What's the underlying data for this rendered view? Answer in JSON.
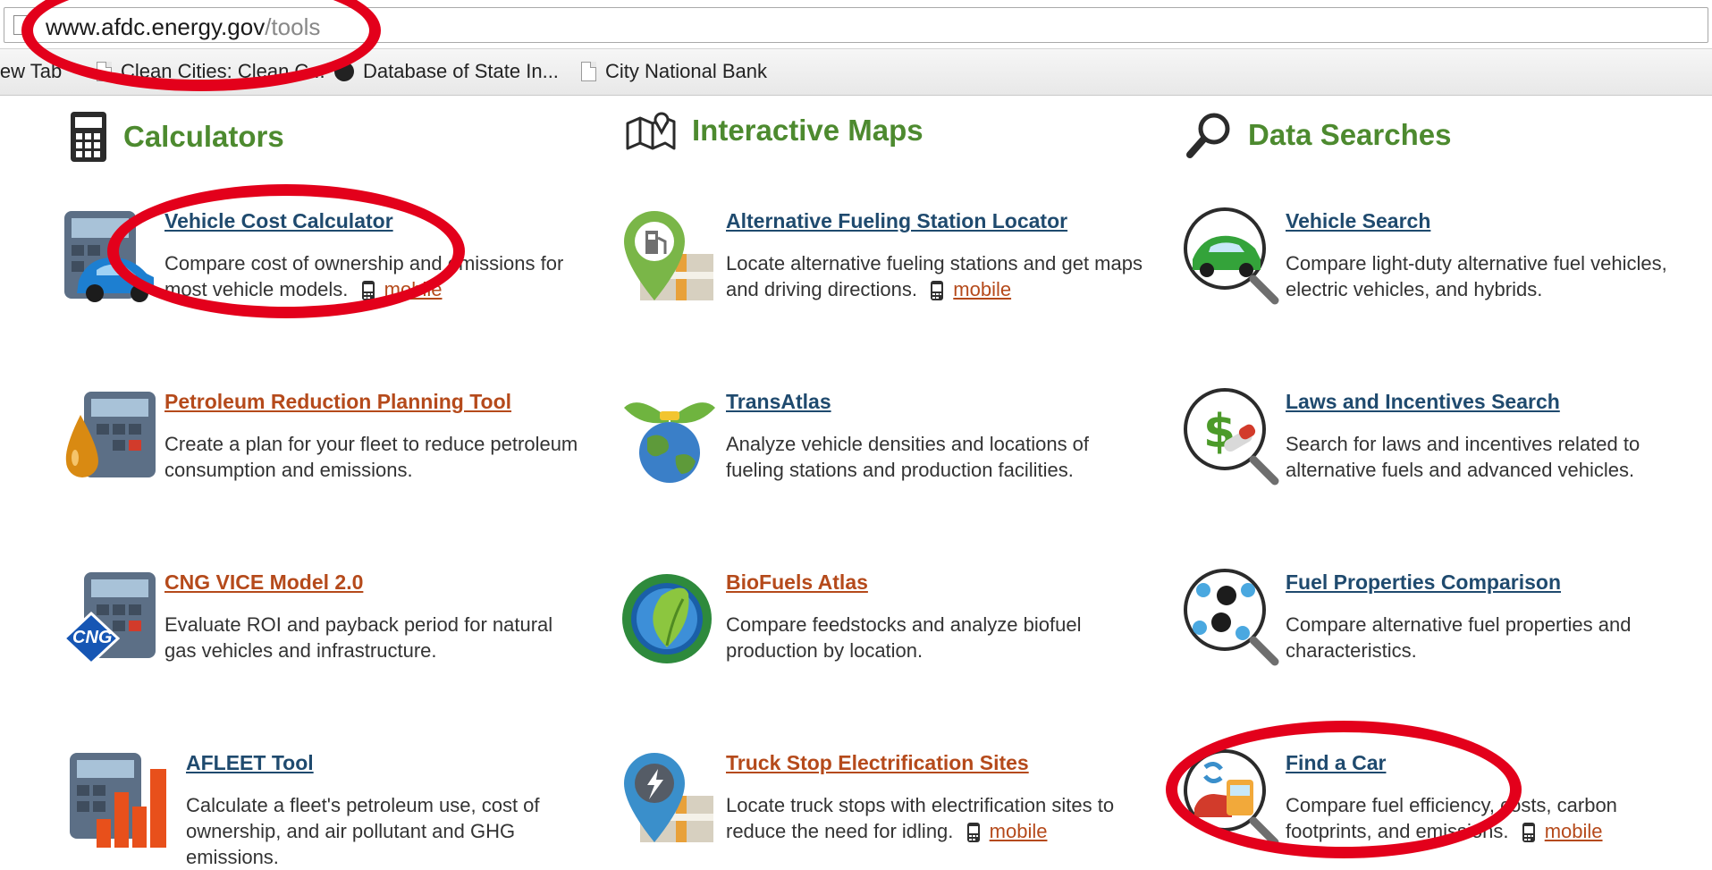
{
  "browser": {
    "url_host": "www.afdc.energy.gov",
    "url_path": "/tools",
    "bookmarks": [
      {
        "label": "New Tab"
      },
      {
        "label": "Clean Cities: Clean C..."
      },
      {
        "label": "Database of State In..."
      },
      {
        "label": "City National Bank"
      }
    ]
  },
  "sections": {
    "calculators": "Calculators",
    "maps": "Interactive Maps",
    "searches": "Data Searches"
  },
  "tools": {
    "vcc": {
      "title": "Vehicle Cost Calculator",
      "desc": "Compare cost of ownership and emissions for most vehicle models.",
      "mobile": "mobile"
    },
    "prpt": {
      "title": "Petroleum Reduction Planning Tool",
      "desc": "Create a plan for your fleet to reduce petroleum consumption and emissions."
    },
    "cng": {
      "title": "CNG VICE Model 2.0",
      "desc": "Evaluate ROI and payback period for natural gas vehicles and infrastructure.",
      "badge": "CNG"
    },
    "afleet": {
      "title": "AFLEET Tool",
      "desc": "Calculate a fleet's petroleum use, cost of ownership, and air pollutant and GHG emissions."
    },
    "afsl": {
      "title": "Alternative Fueling Station Locator",
      "desc": "Locate alternative fueling stations and get maps and driving directions.",
      "mobile": "mobile"
    },
    "transatlas": {
      "title": "TransAtlas",
      "desc": "Analyze vehicle densities and locations of fueling stations and production facilities."
    },
    "biofuels": {
      "title": "BioFuels Atlas",
      "desc": "Compare feedstocks and analyze biofuel production by location."
    },
    "truckstop": {
      "title": "Truck Stop Electrification Sites",
      "desc": "Locate truck stops with electrification sites to reduce the need for idling.",
      "mobile": "mobile"
    },
    "vsearch": {
      "title": "Vehicle Search",
      "desc": "Compare light-duty alternative fuel vehicles, electric vehicles, and hybrids."
    },
    "laws": {
      "title": "Laws and Incentives Search",
      "desc": "Search for laws and incentives related to alternative fuels and advanced vehicles."
    },
    "fuelprops": {
      "title": "Fuel Properties Comparison",
      "desc": "Compare alternative fuel properties and characteristics."
    },
    "findcar": {
      "title": "Find a Car",
      "desc": "Compare fuel efficiency, costs, carbon footprints, and emissions.",
      "mobile": "mobile"
    }
  },
  "colors": {
    "section_green": "#4d8a2f",
    "link_blue": "#1f4a6e",
    "link_orange": "#b54a1b",
    "annotation_red": "#e3001b"
  },
  "icons": [
    "calculator-icon",
    "map-icon",
    "magnifier-icon",
    "phone-icon"
  ]
}
